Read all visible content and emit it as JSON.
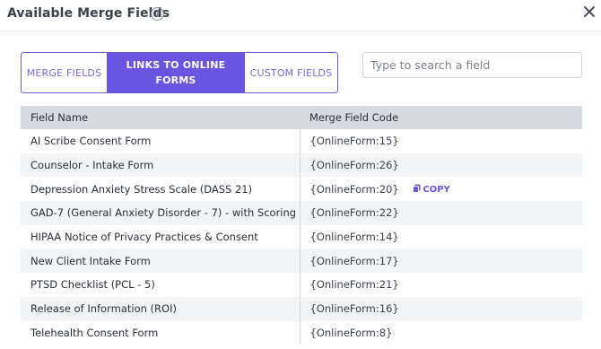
{
  "dialog": {
    "title": "Available Merge Fields",
    "info_icon": "info-circle-icon",
    "close_icon": "close-icon"
  },
  "tabs": [
    {
      "label": "MERGE FIELDS",
      "active": false
    },
    {
      "label": "LINKS TO ONLINE FORMS",
      "active": true
    },
    {
      "label": "CUSTOM FIELDS",
      "active": false
    }
  ],
  "search": {
    "placeholder": "Type to search a field",
    "value": ""
  },
  "table": {
    "headers": [
      "Field Name",
      "Merge Field Code"
    ],
    "rows": [
      {
        "name": "AI Scribe Consent Form",
        "code": "{OnlineForm:15}"
      },
      {
        "name": "Counselor - Intake Form",
        "code": "{OnlineForm:26}"
      },
      {
        "name": "Depression Anxiety Stress Scale (DASS 21)",
        "code": "{OnlineForm:20}",
        "copy": "COPY"
      },
      {
        "name": "GAD-7 (General Anxiety Disorder - 7) - with Scoring",
        "code": "{OnlineForm:22}"
      },
      {
        "name": "HIPAA Notice of Privacy Practices & Consent",
        "code": "{OnlineForm:14}"
      },
      {
        "name": "New Client Intake Form",
        "code": "{OnlineForm:17}"
      },
      {
        "name": "PTSD Checklist (PCL - 5)",
        "code": "{OnlineForm:21}"
      },
      {
        "name": "Release of Information (ROI)",
        "code": "{OnlineForm:16}"
      },
      {
        "name": "Telehealth Consent Form",
        "code": "{OnlineForm:8}"
      }
    ]
  },
  "colors": {
    "accent": "#6a55e0",
    "header_bg": "#d7dae0",
    "row_alt_bg": "#f3f4f6"
  }
}
